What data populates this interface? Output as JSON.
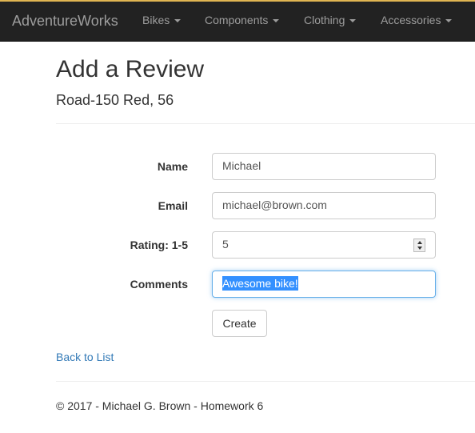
{
  "navbar": {
    "brand": "AdventureWorks",
    "items": [
      {
        "label": "Bikes"
      },
      {
        "label": "Components"
      },
      {
        "label": "Clothing"
      },
      {
        "label": "Accessories"
      }
    ],
    "accent_color": "#e0b552",
    "background_color": "#222222"
  },
  "page": {
    "title": "Add a Review",
    "subtitle": "Road-150 Red, 56"
  },
  "form": {
    "fields": [
      {
        "label": "Name",
        "value": "Michael"
      },
      {
        "label": "Email",
        "value": "michael@brown.com"
      },
      {
        "label": "Rating: 1-5",
        "value": "5"
      },
      {
        "label": "Comments",
        "value": "Awesome bike!"
      }
    ],
    "submit_label": "Create"
  },
  "links": {
    "back": "Back to List"
  },
  "footer": {
    "text": "© 2017 - Michael G. Brown - Homework 6"
  }
}
